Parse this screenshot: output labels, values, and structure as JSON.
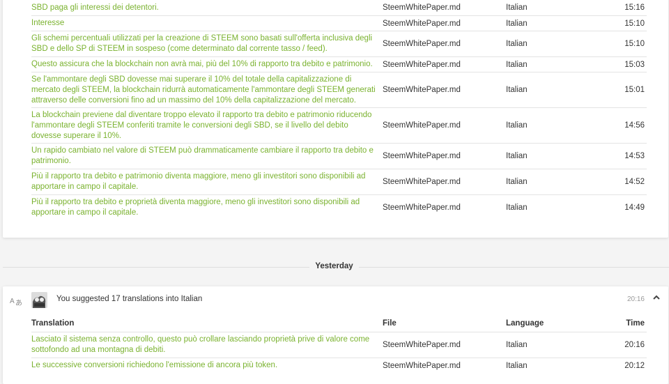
{
  "earlier": {
    "rows": [
      {
        "text": "SBD paga gli interessi dei detentori.",
        "file": "SteemWhitePaper.md",
        "language": "Italian",
        "time": "15:16"
      },
      {
        "text": "Interesse",
        "file": "SteemWhitePaper.md",
        "language": "Italian",
        "time": "15:10"
      },
      {
        "text": "Gli schemi percentuali utilizzati per la creazione di STEEM sono basati sull'offerta inclusiva degli SBD e dello SP di STEEM in sospeso (come determinato dal corrente tasso / feed).",
        "file": "SteemWhitePaper.md",
        "language": "Italian",
        "time": "15:10"
      },
      {
        "text": "Questo assicura che la blockchain non avrà mai, più del 10% di rapporto tra debito e patrimonio.",
        "file": "SteemWhitePaper.md",
        "language": "Italian",
        "time": "15:03"
      },
      {
        "text": "Se l'ammontare degli SBD dovesse mai superare il 10% del totale della capitalizzazione di mercato degli STEEM, la blockchain ridurrà automaticamente l'ammontare degli STEEM generati attraverso delle conversioni fino ad un massimo del 10% della capitalizzazione del mercato.",
        "file": "SteemWhitePaper.md",
        "language": "Italian",
        "time": "15:01"
      },
      {
        "text": "La blockchain previene dal diventare troppo elevato il rapporto tra debito e patrimonio riducendo l'ammontare degli STEEM conferiti tramite le conversioni degli SBD, se il livello del debito dovesse superare il 10%.",
        "file": "SteemWhitePaper.md",
        "language": "Italian",
        "time": "14:56"
      },
      {
        "text": "Un rapido cambiato nel valore di STEEM può drammaticamente cambiare il rapporto tra debito e patrimonio.",
        "file": "SteemWhitePaper.md",
        "language": "Italian",
        "time": "14:53"
      },
      {
        "text": "Più il rapporto tra debito e patrimonio diventa maggiore, meno gli investitori sono disponibili ad apportare in campo il capitale.",
        "file": "SteemWhitePaper.md",
        "language": "Italian",
        "time": "14:52"
      },
      {
        "text": "Più il rapporto tra debito e proprietà diventa maggiore, meno gli investitori sono disponibili ad apportare in campo il capitale.",
        "file": "SteemWhitePaper.md",
        "language": "Italian",
        "time": "14:49"
      }
    ]
  },
  "divider_label": "Yesterday",
  "activity": {
    "summary": "You suggested 17 translations into Italian",
    "timestamp": "20:16",
    "icon": "translate-icon",
    "columns": {
      "translation": "Translation",
      "file": "File",
      "language": "Language",
      "time": "Time"
    },
    "rows": [
      {
        "text": "Lasciato il sistema senza controllo, questo può crollare lasciando proprietà prive di valore come sottofondo ad una montagna di debiti.",
        "file": "SteemWhitePaper.md",
        "language": "Italian",
        "time": "20:16"
      },
      {
        "text": "Le successive conversioni richiedono l'emissione di ancora più token.",
        "file": "SteemWhitePaper.md",
        "language": "Italian",
        "time": "20:12"
      }
    ]
  },
  "colors": {
    "translation_text": "#7ab22f",
    "background": "#f4f4f4"
  }
}
